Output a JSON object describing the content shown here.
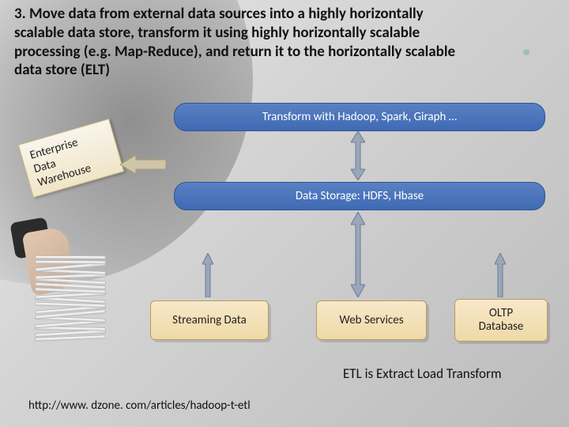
{
  "heading": "3. Move data from external data sources into a highly horizontally scalable data store, transform it using highly horizontally scalable processing (e.g. Map-Reduce), and return it to the horizontally scalable data store (ELT)",
  "transform_label": "Transform with Hadoop, Spark, Giraph …",
  "storage_label": "Data Storage: HDFS, Hbase",
  "sources": {
    "streaming": "Streaming Data",
    "web": "Web Services",
    "oltp_line1": "OLTP",
    "oltp_line2": "Database"
  },
  "edw": {
    "line1": "Enterprise",
    "line2": "Data",
    "line3": "Warehouse"
  },
  "etl_caption": "ETL is Extract Load Transform",
  "url": "http://www. dzone. com/articles/hadoop-t-etl",
  "colors": {
    "pill_bg": "#4a73b8",
    "source_bg": "#f1dcae"
  }
}
